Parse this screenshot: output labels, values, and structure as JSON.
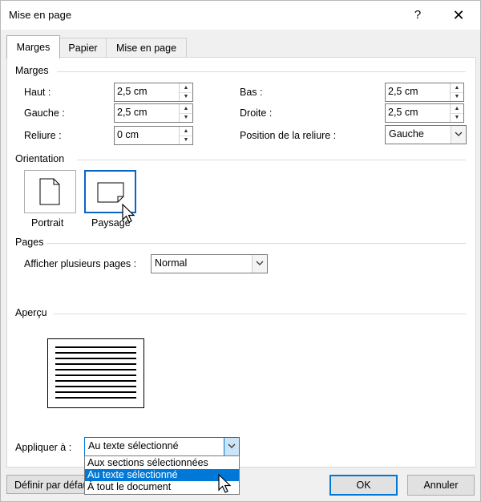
{
  "window": {
    "title": "Mise en page",
    "help": "?",
    "close": "✕"
  },
  "tabs": [
    {
      "label": "Marges"
    },
    {
      "label": "Papier"
    },
    {
      "label": "Mise en page"
    }
  ],
  "margins": {
    "section": "Marges",
    "top_label": "Haut :",
    "top_value": "2,5 cm",
    "bottom_label": "Bas :",
    "bottom_value": "2,5 cm",
    "left_label": "Gauche :",
    "left_value": "2,5 cm",
    "right_label": "Droite :",
    "right_value": "2,5 cm",
    "gutter_label": "Reliure :",
    "gutter_value": "0 cm",
    "gutter_pos_label": "Position de la reliure :",
    "gutter_pos_value": "Gauche"
  },
  "orientation": {
    "section": "Orientation",
    "portrait": "Portrait",
    "landscape": "Paysage"
  },
  "pages": {
    "section": "Pages",
    "multiple_label": "Afficher plusieurs pages :",
    "multiple_value": "Normal"
  },
  "preview": {
    "section": "Aperçu"
  },
  "apply": {
    "label": "Appliquer à :",
    "value": "Au texte sélectionné",
    "options": [
      "Aux sections sélectionnées",
      "Au texte sélectionné",
      "À tout le document"
    ],
    "selected_index": 1
  },
  "footer": {
    "default_button": "Définir par défaut",
    "ok": "OK",
    "cancel": "Annuler"
  },
  "colors": {
    "accent": "#0078d7",
    "selection_border": "#0a64c8"
  }
}
